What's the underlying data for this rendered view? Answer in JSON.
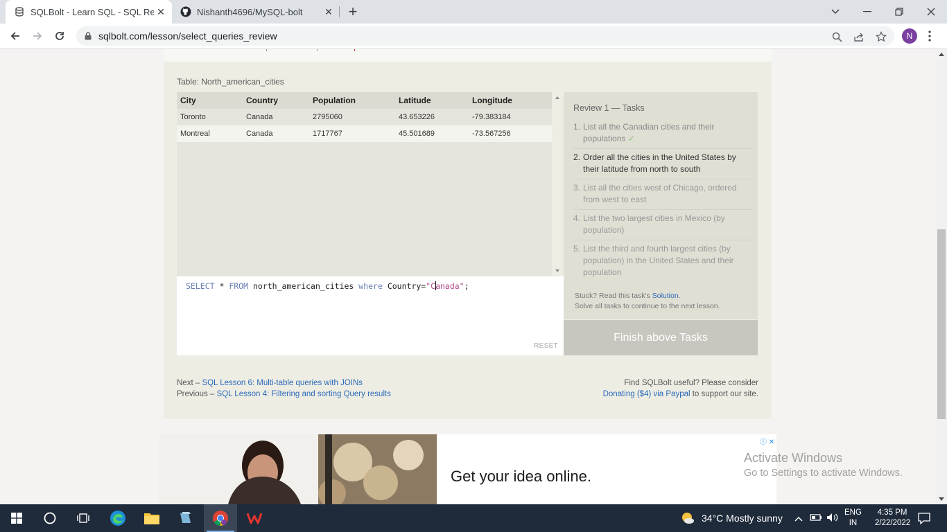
{
  "browser": {
    "tabs": [
      {
        "title": "SQLBolt - Learn SQL - SQL Review",
        "active": true
      },
      {
        "title": "Nishanth4696/MySQL-bolt",
        "active": false
      }
    ],
    "url": "sqlbolt.com/lesson/select_queries_review",
    "profile_initial": "N"
  },
  "lesson": {
    "table_caption": "Table: North_american_cities",
    "columns": [
      "City",
      "Country",
      "Population",
      "Latitude",
      "Longitude"
    ],
    "rows": [
      [
        "Toronto",
        "Canada",
        "2795060",
        "43.653226",
        "-79.383184"
      ],
      [
        "Montreal",
        "Canada",
        "1717767",
        "45.501689",
        "-73.567256"
      ]
    ],
    "query": {
      "select": "SELECT",
      "star": " * ",
      "from": "FROM",
      "table": " north_american_cities ",
      "where": "where",
      "cond": " Country=",
      "str_open": "\"C",
      "str_rest": "anada\"",
      "end": ";"
    },
    "reset_label": "RESET",
    "tasks_title": "Review 1 — Tasks",
    "tasks": [
      {
        "num": "1.",
        "text": "List all the Canadian cities and their populations",
        "check": "✓"
      },
      {
        "num": "2.",
        "text": "Order all the cities in the United States by their latitude from north to south"
      },
      {
        "num": "3.",
        "text": "List all the cities west of Chicago, ordered from west to east"
      },
      {
        "num": "4.",
        "text": "List the two largest cities in Mexico (by population)"
      },
      {
        "num": "5.",
        "text": "List the third and fourth largest cities (by population) in the United States and their population"
      }
    ],
    "stuck_prefix": "Stuck? Read this task's ",
    "solution_link": "Solution",
    "stuck_suffix": ".",
    "solve_all": "Solve all tasks to continue to the next lesson.",
    "finish_button": "Finish above Tasks",
    "next_prefix": "Next – ",
    "next_link": "SQL Lesson 6: Multi-table queries with JOINs",
    "prev_prefix": "Previous – ",
    "prev_link": "SQL Lesson 4: Filtering and sorting Query results",
    "support_line1": "Find SQLBolt useful? Please consider",
    "support_link": "Donating ($4) via Paypal",
    "support_suffix": " to support our site."
  },
  "ad": {
    "headline": "Get your idea online."
  },
  "watermark": {
    "line1": "Activate Windows",
    "line2": "Go to Settings to activate Windows."
  },
  "taskbar": {
    "weather": "34°C  Mostly sunny",
    "lang_line1": "ENG",
    "lang_line2": "IN",
    "time": "4:35 PM",
    "date": "2/22/2022"
  },
  "colors": {
    "link": "#2a6ab8",
    "finish_button": "#c7c6bf",
    "taskbar": "#1f2b3b"
  }
}
